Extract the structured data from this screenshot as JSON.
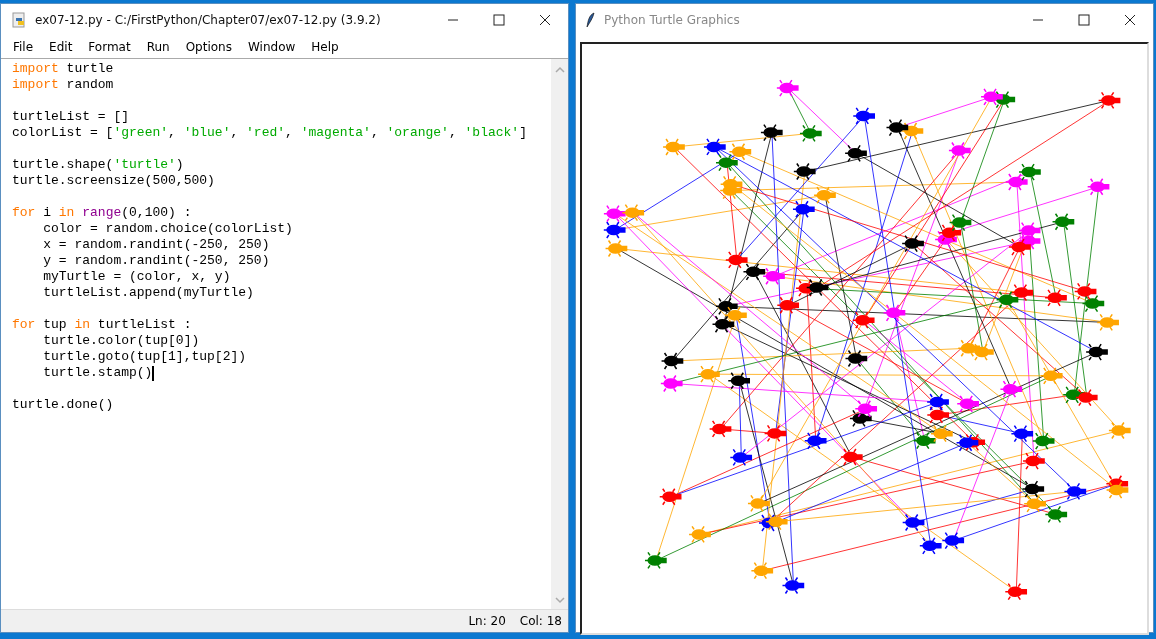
{
  "editor": {
    "title": "ex07-12.py - C:/FirstPython/Chapter07/ex07-12.py (3.9.2)",
    "menu": [
      "File",
      "Edit",
      "Format",
      "Run",
      "Options",
      "Window",
      "Help"
    ],
    "lines": [
      {
        "kind": "code",
        "cursor": false,
        "tokens": [
          {
            "kind": "keyword",
            "text": "import"
          },
          {
            "kind": "plain",
            "text": " turtle"
          }
        ]
      },
      {
        "kind": "code",
        "cursor": false,
        "tokens": [
          {
            "kind": "keyword",
            "text": "import"
          },
          {
            "kind": "plain",
            "text": " random"
          }
        ]
      },
      {
        "kind": "blank"
      },
      {
        "kind": "code",
        "cursor": false,
        "tokens": [
          {
            "kind": "plain",
            "text": "turtleList = []"
          }
        ]
      },
      {
        "kind": "code",
        "cursor": false,
        "tokens": [
          {
            "kind": "plain",
            "text": "colorList = ["
          },
          {
            "kind": "string",
            "text": "'green'"
          },
          {
            "kind": "plain",
            "text": ", "
          },
          {
            "kind": "string",
            "text": "'blue'"
          },
          {
            "kind": "plain",
            "text": ", "
          },
          {
            "kind": "string",
            "text": "'red'"
          },
          {
            "kind": "plain",
            "text": ", "
          },
          {
            "kind": "string",
            "text": "'magenta'"
          },
          {
            "kind": "plain",
            "text": ", "
          },
          {
            "kind": "string",
            "text": "'orange'"
          },
          {
            "kind": "plain",
            "text": ", "
          },
          {
            "kind": "string",
            "text": "'black'"
          },
          {
            "kind": "plain",
            "text": "]"
          }
        ]
      },
      {
        "kind": "blank"
      },
      {
        "kind": "code",
        "cursor": false,
        "tokens": [
          {
            "kind": "plain",
            "text": "turtle.shape("
          },
          {
            "kind": "string",
            "text": "'turtle'"
          },
          {
            "kind": "plain",
            "text": ")"
          }
        ]
      },
      {
        "kind": "code",
        "cursor": false,
        "tokens": [
          {
            "kind": "plain",
            "text": "turtle.screensize(500,500)"
          }
        ]
      },
      {
        "kind": "blank"
      },
      {
        "kind": "code",
        "cursor": false,
        "tokens": [
          {
            "kind": "keyword",
            "text": "for"
          },
          {
            "kind": "plain",
            "text": " i "
          },
          {
            "kind": "keyword",
            "text": "in"
          },
          {
            "kind": "builtin",
            "text": " range"
          },
          {
            "kind": "plain",
            "text": "(0,100) :"
          }
        ]
      },
      {
        "kind": "code",
        "cursor": false,
        "tokens": [
          {
            "kind": "plain",
            "text": "    color = random.choice(colorList)"
          }
        ]
      },
      {
        "kind": "code",
        "cursor": false,
        "tokens": [
          {
            "kind": "plain",
            "text": "    x = random.randint(-250, 250)"
          }
        ]
      },
      {
        "kind": "code",
        "cursor": false,
        "tokens": [
          {
            "kind": "plain",
            "text": "    y = random.randint(-250, 250)"
          }
        ]
      },
      {
        "kind": "code",
        "cursor": false,
        "tokens": [
          {
            "kind": "plain",
            "text": "    myTurtle = (color, x, y)"
          }
        ]
      },
      {
        "kind": "code",
        "cursor": false,
        "tokens": [
          {
            "kind": "plain",
            "text": "    turtleList.append(myTurtle)"
          }
        ]
      },
      {
        "kind": "blank"
      },
      {
        "kind": "code",
        "cursor": false,
        "tokens": [
          {
            "kind": "keyword",
            "text": "for"
          },
          {
            "kind": "plain",
            "text": " tup "
          },
          {
            "kind": "keyword",
            "text": "in"
          },
          {
            "kind": "plain",
            "text": " turtleList :"
          }
        ]
      },
      {
        "kind": "code",
        "cursor": false,
        "tokens": [
          {
            "kind": "plain",
            "text": "    turtle.color(tup[0])"
          }
        ]
      },
      {
        "kind": "code",
        "cursor": false,
        "tokens": [
          {
            "kind": "plain",
            "text": "    turtle.goto(tup[1],tup[2])"
          }
        ]
      },
      {
        "kind": "code",
        "cursor": true,
        "tokens": [
          {
            "kind": "plain",
            "text": "    turtle.stamp()"
          }
        ]
      },
      {
        "kind": "blank"
      },
      {
        "kind": "code",
        "cursor": false,
        "tokens": [
          {
            "kind": "plain",
            "text": "turtle.done()"
          }
        ]
      }
    ],
    "status": {
      "line": "Ln: 20",
      "column": "Col: 18"
    }
  },
  "turtle_window": {
    "title": "Python Turtle Graphics"
  }
}
